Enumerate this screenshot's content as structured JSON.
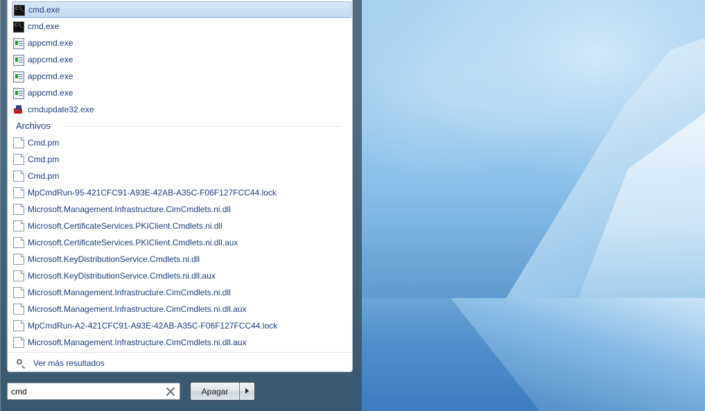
{
  "programs": [
    {
      "label": "cmd.exe",
      "icon": "cmd-icon",
      "selected": true
    },
    {
      "label": "cmd.exe",
      "icon": "cmd-icon"
    },
    {
      "label": "appcmd.exe",
      "icon": "appcmd-icon"
    },
    {
      "label": "appcmd.exe",
      "icon": "appcmd-icon"
    },
    {
      "label": "appcmd.exe",
      "icon": "appcmd-icon"
    },
    {
      "label": "appcmd.exe",
      "icon": "appcmd-icon"
    },
    {
      "label": "cmdupdate32.exe",
      "icon": "installer-icon"
    }
  ],
  "files_section": {
    "title": "Archivos",
    "items": [
      "Cmd.pm",
      "Cmd.pm",
      "Cmd.pm",
      "MpCmdRun-95-421CFC91-A93E-42AB-A35C-F06F127FCC44.lock",
      "Microsoft.Management.Infrastructure.CimCmdlets.ni.dll",
      "Microsoft.CertificateServices.PKIClient.Cmdlets.ni.dll",
      "Microsoft.CertificateServices.PKIClient.Cmdlets.ni.dll.aux",
      "Microsoft.KeyDistributionService.Cmdlets.ni.dll",
      "Microsoft.KeyDistributionService.Cmdlets.ni.dll.aux",
      "Microsoft.Management.Infrastructure.CimCmdlets.ni.dll",
      "Microsoft.Management.Infrastructure.CimCmdlets.ni.dll.aux",
      "MpCmdRun-A2-421CFC91-A93E-42AB-A35C-F06F127FCC44.lock",
      "Microsoft.Management.Infrastructure.CimCmdlets.ni.dll.aux"
    ]
  },
  "more_results": "Ver más resultados",
  "search": {
    "value": "cmd"
  },
  "shutdown": {
    "label": "Apagar"
  },
  "colors": {
    "selection": "#c4d8f2",
    "link_text": "#1e3d78"
  }
}
